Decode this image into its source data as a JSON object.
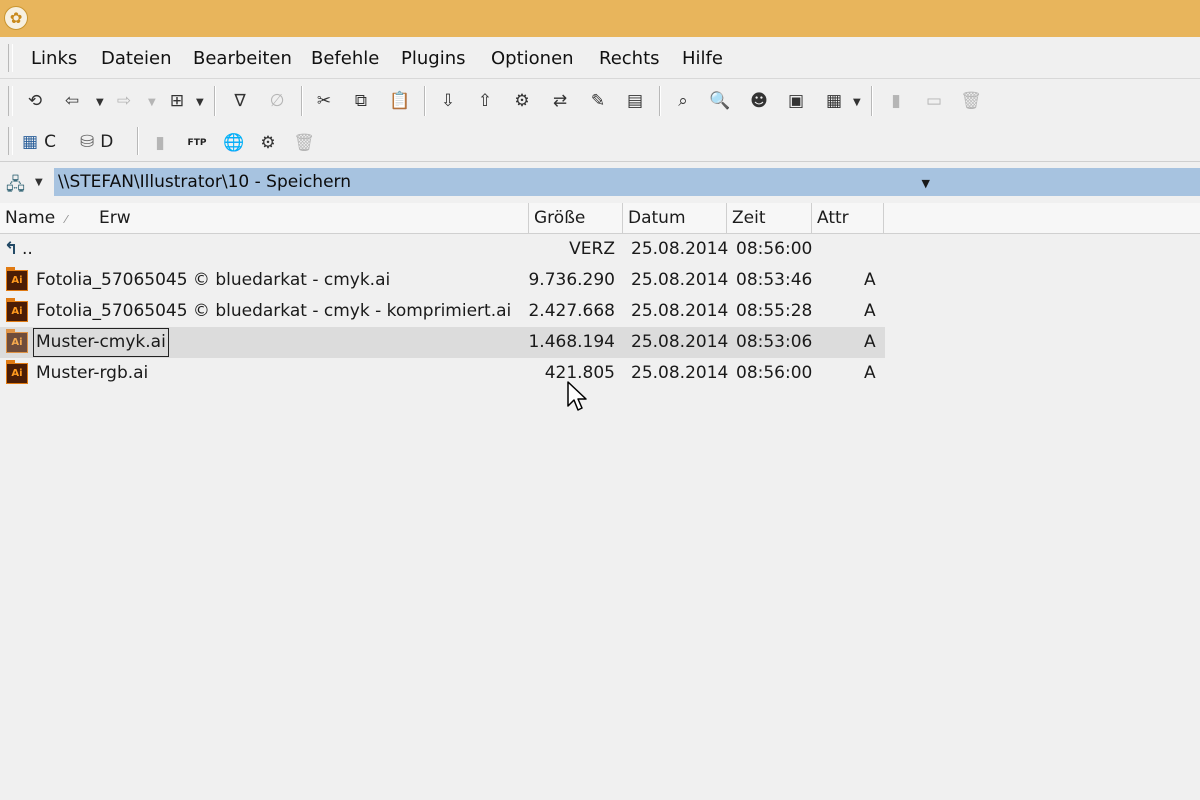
{
  "window": {
    "title_icon": "tree-icon",
    "titlebar_color": "#e8b55c"
  },
  "menu": {
    "items": [
      {
        "label": "Links"
      },
      {
        "label": "Dateien"
      },
      {
        "label": "Bearbeiten"
      },
      {
        "label": "Befehle"
      },
      {
        "label": "Plugins"
      },
      {
        "label": "Optionen"
      },
      {
        "label": "Rechts"
      },
      {
        "label": "Hilfe"
      }
    ]
  },
  "drives": {
    "c_label": "C",
    "d_label": "D"
  },
  "path": {
    "value": "\\\\STEFAN\\Illustrator\\10 - Speichern",
    "highlight_color": "#a7c3e0"
  },
  "columns": {
    "name": "Name",
    "ext": "Erw",
    "size": "Größe",
    "date": "Datum",
    "time": "Zeit",
    "attr": "Attr"
  },
  "files": [
    {
      "name": "..",
      "size": "VERZ",
      "date": "25.08.2014",
      "time": "08:56:00",
      "attr": "",
      "icon": "parent-folder-icon"
    },
    {
      "name": "Fotolia_57065045 © bluedarkat - cmyk.ai",
      "size": "9.736.290",
      "date": "25.08.2014",
      "time": "08:53:46",
      "attr": "A",
      "icon": "illustrator-file-icon"
    },
    {
      "name": "Fotolia_57065045 © bluedarkat - cmyk - komprimiert.ai",
      "size": "2.427.668",
      "date": "25.08.2014",
      "time": "08:55:28",
      "attr": "A",
      "icon": "illustrator-file-icon"
    },
    {
      "name": "Muster-cmyk.ai",
      "size": "1.468.194",
      "date": "25.08.2014",
      "time": "08:53:06",
      "attr": "A",
      "icon": "illustrator-file-icon",
      "selected": true
    },
    {
      "name": "Muster-rgb.ai",
      "size": "421.805",
      "date": "25.08.2014",
      "time": "08:56:00",
      "attr": "A",
      "icon": "illustrator-file-icon"
    }
  ],
  "icon_labels": {
    "ai": "Ai",
    "ftp": "FTP"
  }
}
